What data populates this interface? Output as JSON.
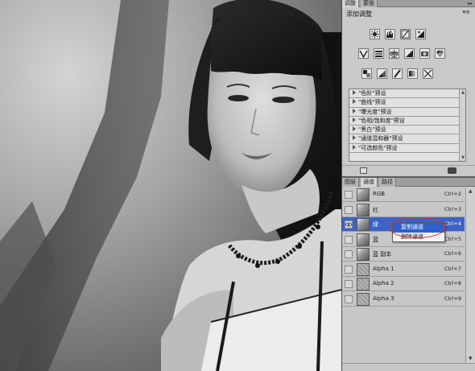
{
  "adjustments_panel": {
    "tabs": [
      {
        "label": "调整",
        "active": true
      },
      {
        "label": "蒙版",
        "active": false
      }
    ],
    "title": "添加调整",
    "menu_glyph": "▾≡",
    "icon_rows": [
      [
        "brightness-contrast-icon",
        "levels-icon",
        "curves-icon",
        "exposure-icon"
      ],
      [
        "vibrance-icon",
        "hue-saturation-icon",
        "color-balance-icon",
        "black-white-icon",
        "photo-filter-icon",
        "channel-mixer-icon"
      ],
      [
        "invert-icon",
        "posterize-icon",
        "threshold-icon",
        "gradient-map-icon",
        "selective-color-icon"
      ]
    ],
    "presets": [
      "\"色阶\"预设",
      "\"曲线\"预设",
      "\"曝光度\"预设",
      "\"色相/饱和度\"预设",
      "\"黑白\"预设",
      "\"通道混和器\"预设",
      "\"可选颜色\"预设"
    ]
  },
  "channels_panel": {
    "tabs": [
      {
        "label": "图层",
        "active": false
      },
      {
        "label": "通道",
        "active": true
      },
      {
        "label": "路径",
        "active": false
      }
    ],
    "channels": [
      {
        "name": "RGB",
        "shortcut": "Ctrl+2",
        "visible": false,
        "selected": false,
        "alpha": false
      },
      {
        "name": "红",
        "shortcut": "Ctrl+3",
        "visible": false,
        "selected": false,
        "alpha": false
      },
      {
        "name": "绿",
        "shortcut": "Ctrl+4",
        "visible": true,
        "selected": true,
        "alpha": false
      },
      {
        "name": "蓝",
        "shortcut": "Ctrl+5",
        "visible": false,
        "selected": false,
        "alpha": false
      },
      {
        "name": "蓝 副本",
        "shortcut": "Ctrl+6",
        "visible": false,
        "selected": false,
        "alpha": false
      },
      {
        "name": "Alpha 1",
        "shortcut": "Ctrl+7",
        "visible": false,
        "selected": false,
        "alpha": true
      },
      {
        "name": "Alpha 2",
        "shortcut": "Ctrl+8",
        "visible": false,
        "selected": false,
        "alpha": true
      },
      {
        "name": "Alpha 3",
        "shortcut": "Ctrl+9",
        "visible": false,
        "selected": false,
        "alpha": true
      }
    ]
  },
  "context_menu": {
    "items": [
      {
        "label": "复制通道",
        "hover": true
      },
      {
        "label": "删除通道",
        "hover": false
      }
    ]
  },
  "colors": {
    "selection": "#3d62c8",
    "annotation": "#d23434",
    "panel_bg": "#c9c9c9"
  }
}
